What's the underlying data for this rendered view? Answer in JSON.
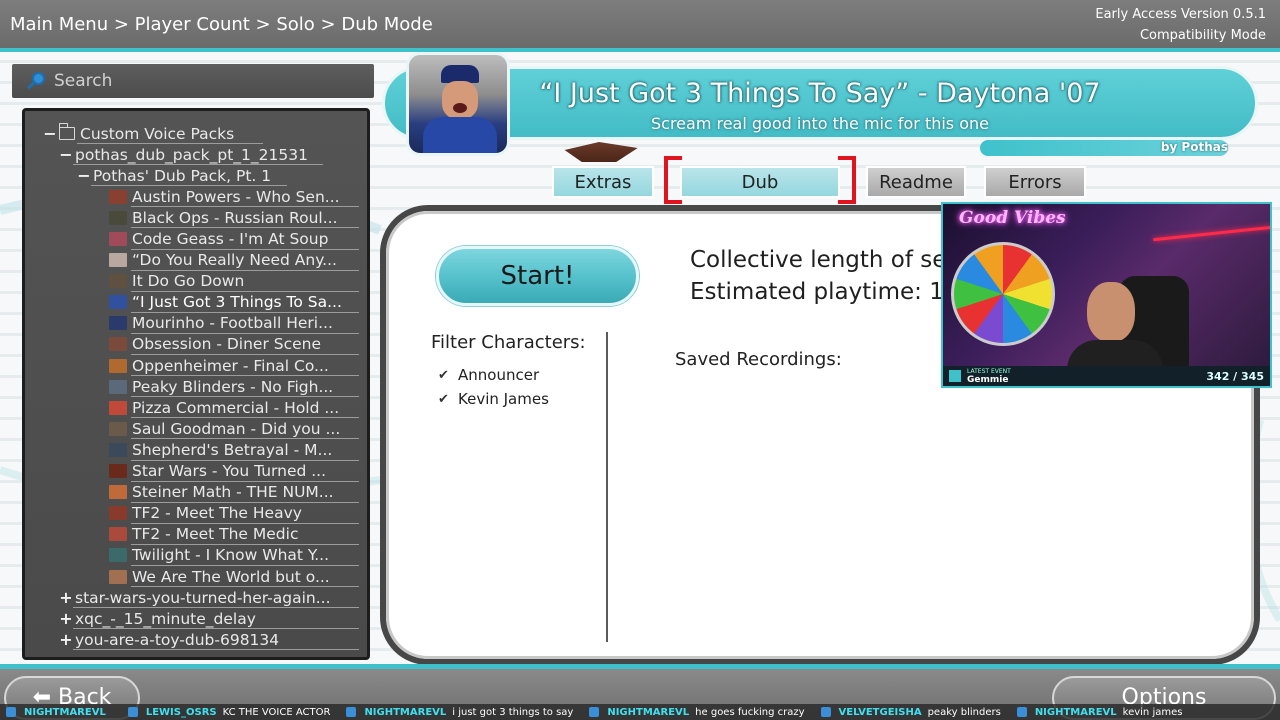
{
  "header": {
    "breadcrumb": "Main Menu > Player Count > Solo > Dub Mode",
    "version": "Early Access Version 0.5.1",
    "mode": "Compatibility Mode"
  },
  "search": {
    "placeholder": "Search",
    "icon": "search-icon"
  },
  "tree": {
    "root": "Custom Voice Packs",
    "pack": "pothas_dub_pack_pt_1_21531",
    "subpack": "Pothas' Dub Pack, Pt. 1",
    "items": [
      {
        "label": "Austin Powers - Who Sen...",
        "color": "#8a4030"
      },
      {
        "label": "Black Ops - Russian Roul...",
        "color": "#4a4a3a"
      },
      {
        "label": "Code Geass - I'm At Soup",
        "color": "#a04a5a"
      },
      {
        "label": "“Do You Really Need Any...",
        "color": "#b8a8a0"
      },
      {
        "label": "It Do Go Down",
        "color": "#605040"
      },
      {
        "label": "“I Just Got 3 Things To Sa...",
        "color": "#3050a0",
        "selected": true
      },
      {
        "label": "Mourinho - Football Heri...",
        "color": "#2a3a6a"
      },
      {
        "label": "Obsession - Diner Scene",
        "color": "#7a4a3a"
      },
      {
        "label": "Oppenheimer - Final Co...",
        "color": "#b06a30"
      },
      {
        "label": "Peaky Blinders - No Figh...",
        "color": "#5a6a7a"
      },
      {
        "label": "Pizza Commercial - Hold ...",
        "color": "#c04a3a"
      },
      {
        "label": "Saul Goodman - Did you ...",
        "color": "#6a5a4a"
      },
      {
        "label": "Shepherd's Betrayal - M...",
        "color": "#3a4a5a"
      },
      {
        "label": "Star Wars - You Turned ...",
        "color": "#6a2a1a"
      },
      {
        "label": "Steiner Math - THE NUM...",
        "color": "#c06a3a"
      },
      {
        "label": "TF2 - Meet The Heavy",
        "color": "#8a3a2a"
      },
      {
        "label": "TF2 - Meet The Medic",
        "color": "#aa4a3a"
      },
      {
        "label": "Twilight - I Know What Y...",
        "color": "#3a6a6a"
      },
      {
        "label": "We Are The World but o...",
        "color": "#a07050"
      }
    ],
    "collapsed": [
      "star-wars-you-turned-her-again...",
      "xqc_-_15_minute_delay",
      "you-are-a-toy-dub-698134"
    ]
  },
  "banner": {
    "title": "“I Just Got 3 Things To Say” - Daytona '07",
    "subtitle": "Scream real good into the mic for this one",
    "author": "by Pothas"
  },
  "tabs": {
    "extras": "Extras",
    "dub": "Dub",
    "readme": "Readme",
    "errors": "Errors"
  },
  "main": {
    "start_label": "Start!",
    "length_line1": "Collective length of se",
    "length_line2": "Estimated playtime:  1",
    "filter_title": "Filter Characters:",
    "filters": [
      "Announcer",
      "Kevin James"
    ],
    "saved_label": "Saved Recordings:"
  },
  "webcam": {
    "sign": "Good Vibes",
    "event_label": "LATEST EVENT",
    "event_name": "Gemmie",
    "goal": "342 / 345"
  },
  "footer": {
    "back_label": "Back",
    "options_label": "Options"
  },
  "ticker": [
    {
      "name": "NIGHTMAREVL",
      "msg": ""
    },
    {
      "name": "LEWIS_OSRS",
      "msg": "KC THE VOICE ACTOR"
    },
    {
      "name": "NIGHTMAREVL",
      "msg": "i just got 3 things to say"
    },
    {
      "name": "NIGHTMAREVL",
      "msg": "he goes fucking crazy"
    },
    {
      "name": "VELVETGEISHA",
      "msg": "peaky blinders"
    },
    {
      "name": "NIGHTMAREVL",
      "msg": "kevin james"
    }
  ],
  "colors": {
    "accent": "#3fc1cb",
    "selection_red": "#e0141e"
  }
}
